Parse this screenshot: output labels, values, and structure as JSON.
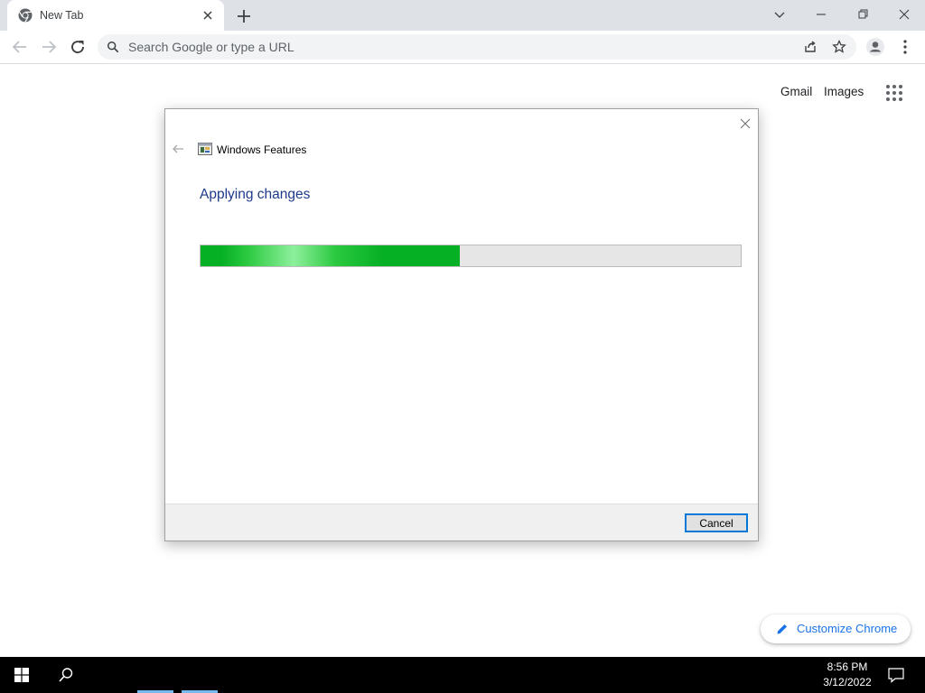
{
  "browser": {
    "tab": {
      "title": "New Tab",
      "close_icon": "close-icon",
      "favicon": "chrome-icon"
    },
    "new_tab_icon": "plus-icon",
    "window_controls": [
      "chevron-down-icon",
      "minimize-icon",
      "restore-icon",
      "close-icon"
    ],
    "toolbar": {
      "back_icon": "arrow-left-icon",
      "forward_icon": "arrow-right-icon",
      "reload_icon": "reload-icon",
      "omnibox_placeholder": "Search Google or type a URL",
      "share_icon": "share-icon",
      "bookmark_icon": "star-icon",
      "profile_icon": "profile-icon",
      "menu_icon": "kebab-menu-icon"
    }
  },
  "ntp": {
    "links": {
      "gmail": "Gmail",
      "images": "Images"
    },
    "apps_icon": "apps-grid-icon",
    "customize_label": "Customize Chrome"
  },
  "dialog": {
    "title": "Windows Features",
    "heading": "Applying changes",
    "progress": 0.48,
    "cancel_label": "Cancel"
  },
  "taskbar": {
    "time": "8:56 PM",
    "date": "3/12/2022"
  },
  "colors": {
    "tabstrip": "#dee1e6",
    "omnibox": "#f1f3f4",
    "progress_green": "#06b025",
    "dialog_heading": "#1e3a8a",
    "accent": "#1a73e8"
  }
}
